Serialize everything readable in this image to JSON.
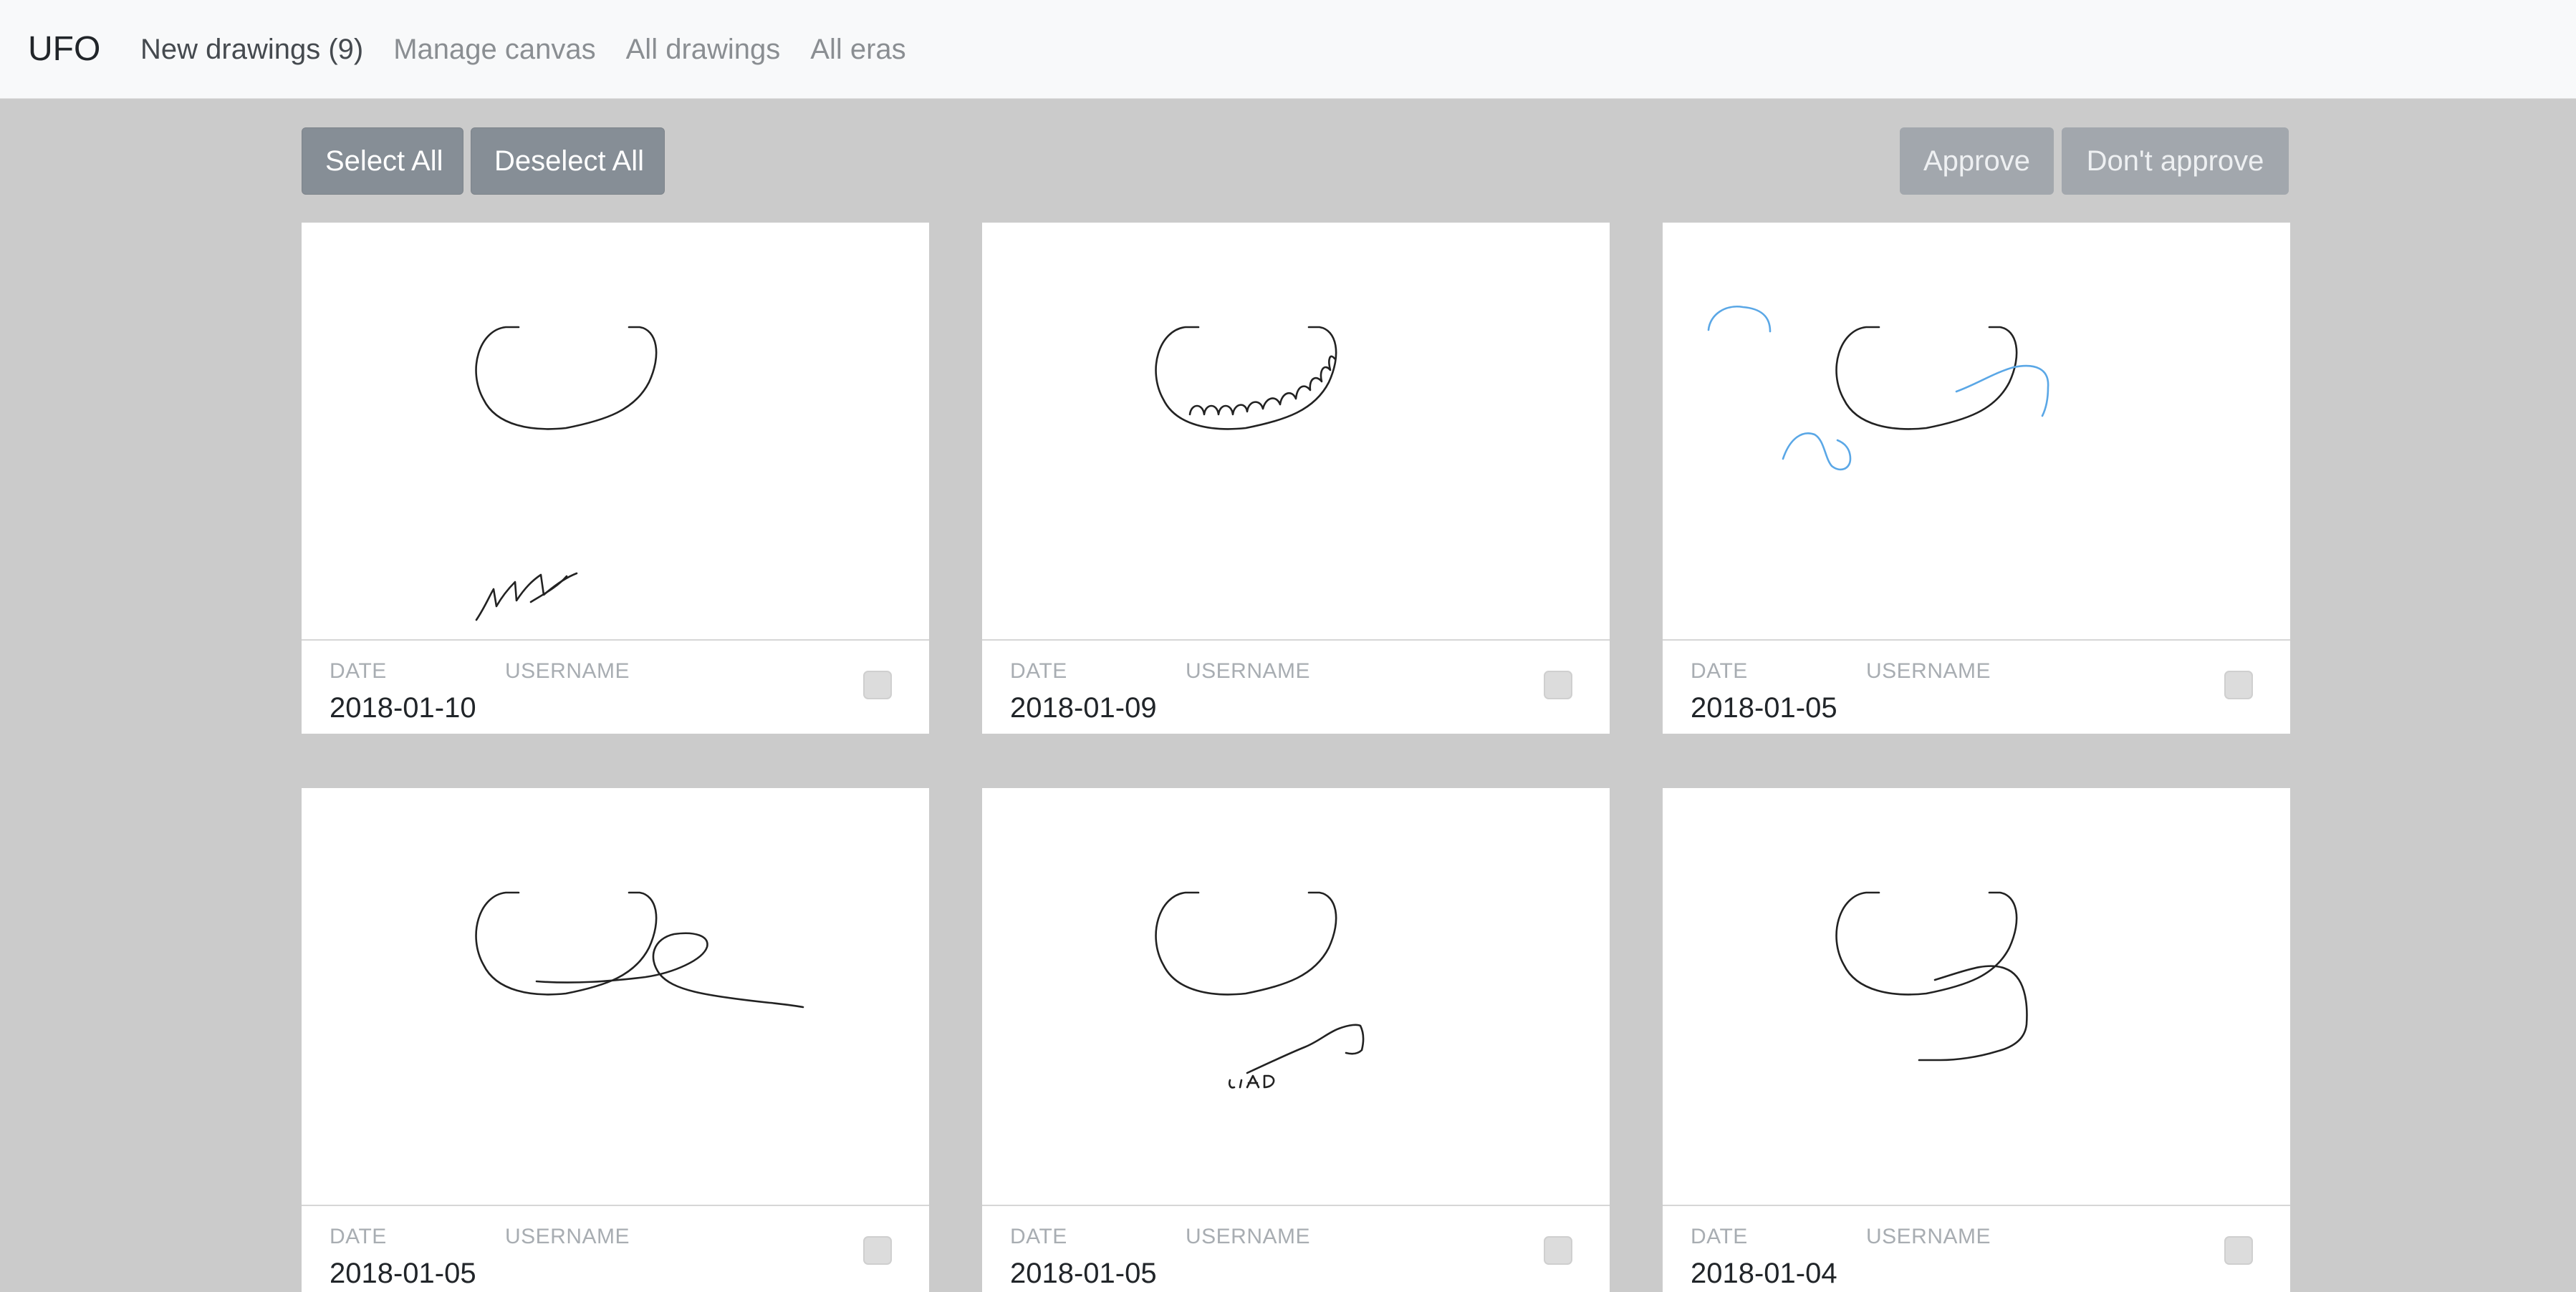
{
  "navbar": {
    "brand": "UFO",
    "links": [
      {
        "label": "New drawings (9)",
        "active": true
      },
      {
        "label": "Manage canvas",
        "active": false
      },
      {
        "label": "All drawings",
        "active": false
      },
      {
        "label": "All eras",
        "active": false
      }
    ]
  },
  "toolbar": {
    "select_all": "Select All",
    "deselect_all": "Deselect All",
    "approve": "Approve",
    "dont_approve": "Don't approve"
  },
  "card_labels": {
    "date": "DATE",
    "username": "USERNAME"
  },
  "drawings": [
    {
      "date": "2018-01-10",
      "username": "",
      "checked": false
    },
    {
      "date": "2018-01-09",
      "username": "",
      "checked": false
    },
    {
      "date": "2018-01-05",
      "username": "",
      "checked": false
    },
    {
      "date": "2018-01-05",
      "username": "",
      "checked": false
    },
    {
      "date": "2018-01-05",
      "username": "",
      "checked": false
    },
    {
      "date": "2018-01-04",
      "username": "",
      "checked": false
    }
  ],
  "colors": {
    "background": "#cbcbcb",
    "navbar": "#f8f9fa",
    "button": "#868e96",
    "button_faded": "#a2a7ad",
    "stroke_black": "#222222",
    "stroke_blue": "#5aa7e6"
  }
}
